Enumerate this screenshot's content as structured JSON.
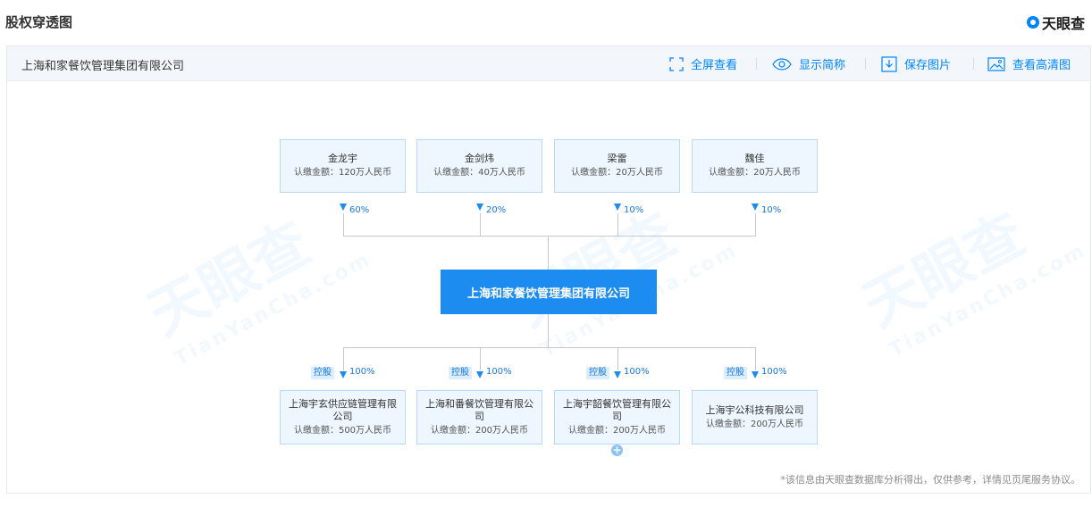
{
  "header": {
    "title": "股权穿透图",
    "brand": "天眼查",
    "brand_icon": "tianyancha-logo-icon"
  },
  "toolbar": {
    "company": "上海和家餐饮管理集团有限公司",
    "fullscreen": "全屏查看",
    "simplify": "显示简称",
    "save": "保存图片",
    "hd": "查看高清图"
  },
  "watermark": {
    "cn": "天眼查",
    "en": "TianYanCha.com"
  },
  "shareholders": [
    {
      "name": "金龙宇",
      "amount": "认缴金额：120万人民币",
      "percent": "60%"
    },
    {
      "name": "金剑炜",
      "amount": "认缴金额：40万人民币",
      "percent": "20%"
    },
    {
      "name": "梁雷",
      "amount": "认缴金额：20万人民币",
      "percent": "10%"
    },
    {
      "name": "魏佳",
      "amount": "认缴金额：20万人民币",
      "percent": "10%"
    }
  ],
  "center": {
    "name": "上海和家餐饮管理集团有限公司"
  },
  "subsidiaries": [
    {
      "tag": "控股",
      "percent": "100%",
      "name": "上海宇玄供应链管理有限公司",
      "amount": "认缴金额：500万人民币"
    },
    {
      "tag": "控股",
      "percent": "100%",
      "name": "上海和番餐饮管理有限公司",
      "amount": "认缴金额：200万人民币"
    },
    {
      "tag": "控股",
      "percent": "100%",
      "name": "上海宇韶餐饮管理有限公司",
      "amount": "认缴金额：200万人民币"
    },
    {
      "tag": "控股",
      "percent": "100%",
      "name": "上海宇公科技有限公司",
      "amount": "认缴金额：200万人民币"
    }
  ],
  "expand": "+",
  "footnote": "*该信息由天眼查数据库分析得出，仅供参考，详情见页尾服务协议。",
  "colors": {
    "accent": "#1c8cf0",
    "link": "#0084ff",
    "node_bg": "#eef6ff",
    "node_border": "#b8d9fb"
  }
}
